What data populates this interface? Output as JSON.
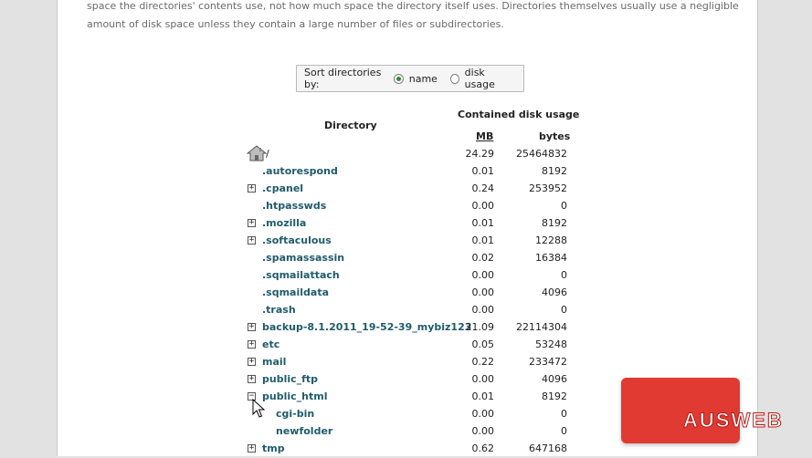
{
  "intro": {
    "line1": "space the directories' contents use, not how much space the directory itself uses. Directories themselves usually use a negligible",
    "line2": "amount of disk space unless they contain a large number of files or subdirectories."
  },
  "sort": {
    "label": "Sort directories by:",
    "options": [
      {
        "label": "name",
        "checked": true
      },
      {
        "label": "disk usage",
        "checked": false
      }
    ]
  },
  "table": {
    "col_directory": "Directory",
    "col_usage": "Contained disk usage",
    "col_mb": "MB",
    "col_bytes": "bytes",
    "rows": [
      {
        "name": "/",
        "mb": "24.29",
        "bytes": "25464832",
        "expander": "",
        "home": true,
        "indent": 0
      },
      {
        "name": ".autorespond",
        "mb": "0.01",
        "bytes": "8192",
        "expander": "",
        "indent": 1
      },
      {
        "name": ".cpanel",
        "mb": "0.24",
        "bytes": "253952",
        "expander": "+",
        "indent": 1
      },
      {
        "name": ".htpasswds",
        "mb": "0.00",
        "bytes": "0",
        "expander": "",
        "indent": 1
      },
      {
        "name": ".mozilla",
        "mb": "0.01",
        "bytes": "8192",
        "expander": "+",
        "indent": 1
      },
      {
        "name": ".softaculous",
        "mb": "0.01",
        "bytes": "12288",
        "expander": "+",
        "indent": 1
      },
      {
        "name": ".spamassassin",
        "mb": "0.02",
        "bytes": "16384",
        "expander": "",
        "indent": 1
      },
      {
        "name": ".sqmailattach",
        "mb": "0.00",
        "bytes": "0",
        "expander": "",
        "indent": 1
      },
      {
        "name": ".sqmaildata",
        "mb": "0.00",
        "bytes": "4096",
        "expander": "",
        "indent": 1
      },
      {
        "name": ".trash",
        "mb": "0.00",
        "bytes": "0",
        "expander": "",
        "indent": 1
      },
      {
        "name": "backup-8.1.2011_19-52-39_mybiz123",
        "mb": "21.09",
        "bytes": "22114304",
        "expander": "+",
        "indent": 1
      },
      {
        "name": "etc",
        "mb": "0.05",
        "bytes": "53248",
        "expander": "+",
        "indent": 1
      },
      {
        "name": "mail",
        "mb": "0.22",
        "bytes": "233472",
        "expander": "+",
        "indent": 1
      },
      {
        "name": "public_ftp",
        "mb": "0.00",
        "bytes": "4096",
        "expander": "+",
        "indent": 1
      },
      {
        "name": "public_html",
        "mb": "0.01",
        "bytes": "8192",
        "expander": "−",
        "indent": 1
      },
      {
        "name": "cgi-bin",
        "mb": "0.00",
        "bytes": "0",
        "expander": "",
        "indent": 2
      },
      {
        "name": "newfolder",
        "mb": "0.00",
        "bytes": "0",
        "expander": "",
        "indent": 2
      },
      {
        "name": "tmp",
        "mb": "0.62",
        "bytes": "647168",
        "expander": "+",
        "indent": 1
      }
    ]
  },
  "logo": {
    "text": "AUSWEB",
    "color": "#e03a32"
  },
  "icons": {
    "home": "home-icon",
    "expand": "expand-icon",
    "collapse": "collapse-icon",
    "cursor": "mouse-pointer-icon"
  }
}
